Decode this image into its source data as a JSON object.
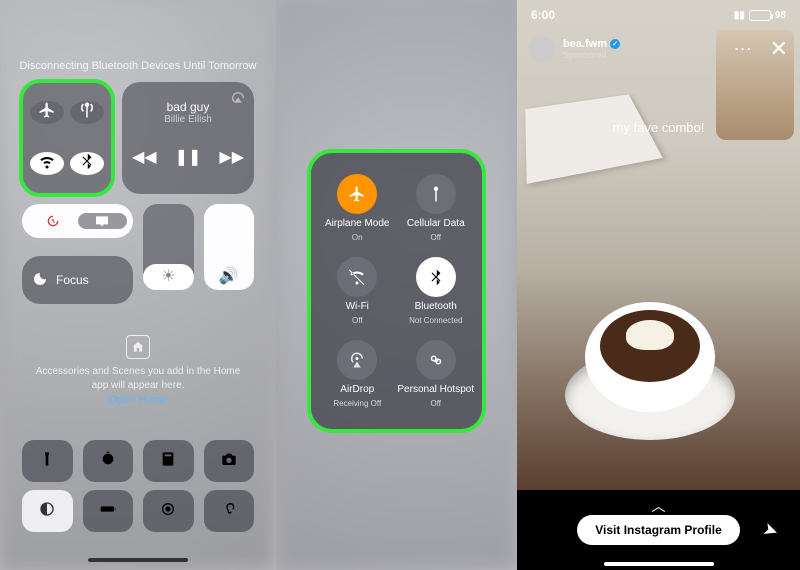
{
  "panel1": {
    "top_message": "Disconnecting Bluetooth Devices Until Tomorrow",
    "music": {
      "title": "bad guy",
      "artist": "Billie Eilish"
    },
    "focus_label": "Focus",
    "home_text": "Accessories and Scenes you add in the Home app will appear here.",
    "open_home": "Open Home"
  },
  "panel2": {
    "items": [
      {
        "label": "Airplane Mode",
        "status": "On"
      },
      {
        "label": "Cellular Data",
        "status": "Off"
      },
      {
        "label": "Wi-Fi",
        "status": "Off"
      },
      {
        "label": "Bluetooth",
        "status": "Not Connected"
      },
      {
        "label": "AirDrop",
        "status": "Receiving Off"
      },
      {
        "label": "Personal Hotspot",
        "status": "Off"
      }
    ]
  },
  "panel3": {
    "time": "6:00",
    "battery": "98",
    "username": "bea.fwm",
    "sponsored": "Sponsored",
    "caption": "my fave combo!",
    "cta": "Visit Instagram Profile"
  }
}
